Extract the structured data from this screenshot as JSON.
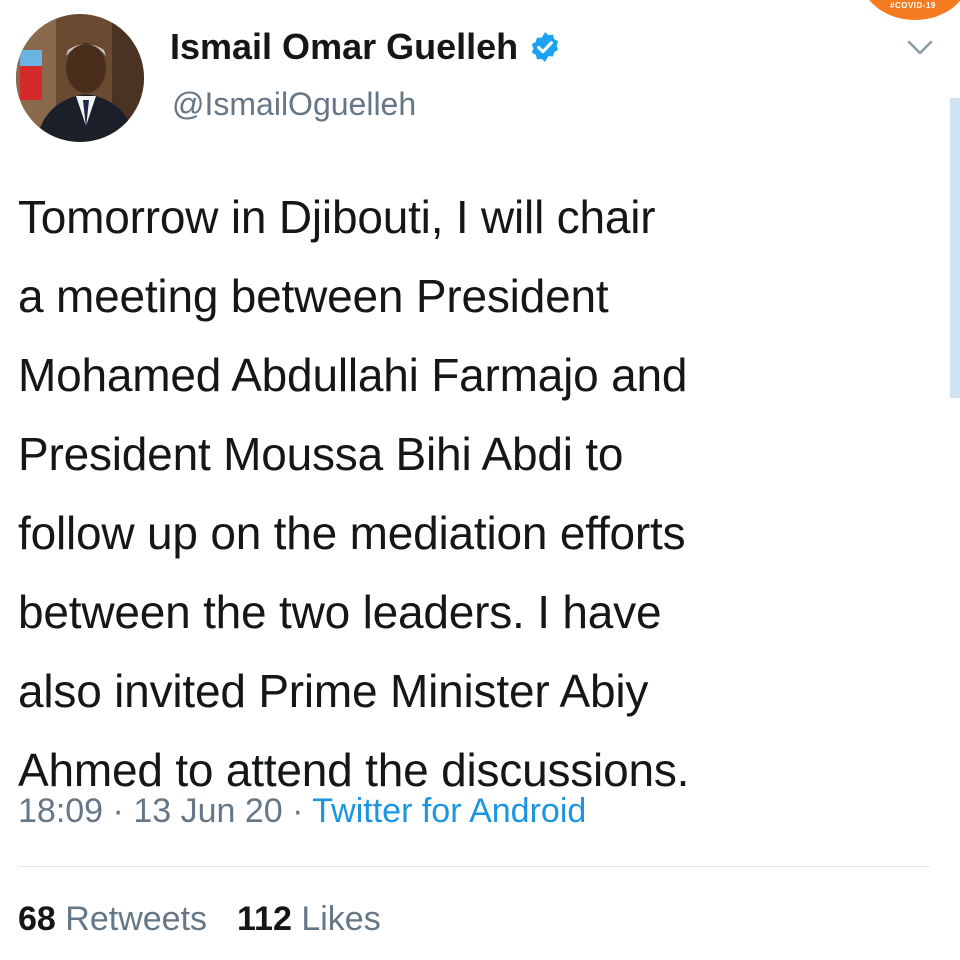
{
  "corner_badge": {
    "text": "#COVID-19",
    "color": "#f47b20"
  },
  "author": {
    "display_name": "Ismail Omar Guelleh",
    "handle": "@IsmailOguelleh",
    "verified": true,
    "avatar_icon": "profile-photo-avatar"
  },
  "menu": {
    "icon": "chevron-down-icon"
  },
  "tweet": {
    "lines": [
      "Tomorrow in Djibouti, I will chair",
      "a meeting between President",
      "Mohamed Abdullahi Farmajo and",
      "President Moussa Bihi Abdi to",
      "follow up on the mediation efforts",
      "between the two leaders. I have",
      "also invited Prime Minister Abiy",
      "Ahmed to attend the discussions."
    ]
  },
  "meta": {
    "time": "18:09",
    "sep1": " · ",
    "date": "13 Jun 20",
    "sep2": " · ",
    "source": "Twitter for Android"
  },
  "stats": {
    "retweets_count": "68",
    "retweets_label": "Retweets",
    "likes_count": "112",
    "likes_label": "Likes"
  },
  "colors": {
    "text": "#14171a",
    "secondary": "#657786",
    "link": "#1b95e0",
    "verified": "#1da1f2"
  }
}
